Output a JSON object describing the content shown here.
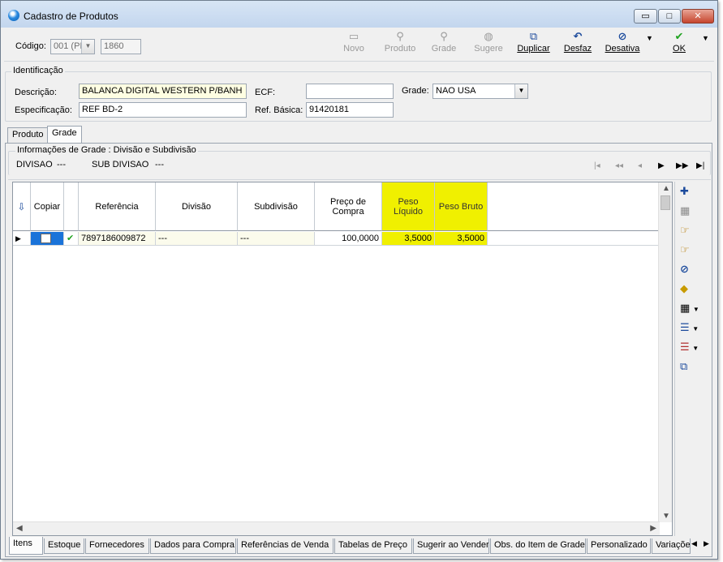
{
  "window": {
    "title": "Cadastro de Produtos",
    "controls": {
      "minimize": "▭",
      "maximize": "□",
      "close": "✕"
    }
  },
  "header": {
    "codigo_label": "Código:",
    "codigo_value": "001 (PI",
    "codigo_number": "1860"
  },
  "toolbar": {
    "items": [
      {
        "label": "Novo",
        "icon": "new-icon",
        "enabled": false
      },
      {
        "label": "Produto",
        "icon": "search-icon",
        "enabled": false
      },
      {
        "label": "Grade",
        "icon": "search-icon",
        "enabled": false
      },
      {
        "label": "Sugere",
        "icon": "suggest-icon",
        "enabled": false
      },
      {
        "label": "Duplicar",
        "icon": "duplicate-icon",
        "enabled": true
      },
      {
        "label": "Desfaz",
        "icon": "undo-icon",
        "enabled": true
      },
      {
        "label": "Desativa",
        "icon": "deactivate-icon",
        "enabled": true
      },
      {
        "label": "OK",
        "icon": "check-icon",
        "enabled": true
      }
    ],
    "accent": "#1b4a9c"
  },
  "identificacao": {
    "title": "Identificação",
    "descricao_label": "Descrição:",
    "descricao_value": "BALANCA DIGITAL WESTERN P/BANH",
    "ecf_label": "ECF:",
    "ecf_value": "",
    "grade_label": "Grade:",
    "grade_value": "NAO USA",
    "especificacao_label": "Especificação:",
    "especificacao_value": "REF BD-2",
    "ref_basica_label": "Ref. Básica:",
    "ref_basica_value": "91420181"
  },
  "page_tabs": [
    "Produto",
    "Grade"
  ],
  "active_page_tab": "Grade",
  "grade_info": {
    "title": "Informações de Grade : Divisão e Subdivisão",
    "divisao_label": "DIVISAO",
    "divisao_value": "---",
    "subdivisao_label": "SUB DIVISAO",
    "subdivisao_value": "---",
    "nav": [
      "|◂",
      "◂◂",
      "◂",
      "▶",
      "▶▶",
      "▶|"
    ]
  },
  "grid": {
    "columns": [
      "Copiar",
      "Referência",
      "Divisão",
      "Subdivisão",
      "Preço de Compra",
      "Peso Líquido",
      "Peso Bruto"
    ],
    "rows": [
      {
        "copiar": "",
        "referencia": "7897186009872",
        "divisao": "---",
        "subdivisao": "---",
        "preco_compra": "100,0000",
        "peso_liquido": "3,5000",
        "peso_bruto": "3,5000"
      }
    ],
    "highlight_color": "#f0f000"
  },
  "side_toolbar": [
    "add-row-icon",
    "delete-row-icon",
    "move-down-icon",
    "move-up-icon",
    "deactivate-icon",
    "diamond-icon",
    "layout-icon",
    "list-icon",
    "list-alt-icon",
    "copy-icon"
  ],
  "bottom_tabs": [
    "Itens",
    "Estoque",
    "Fornecedores",
    "Dados para Compra",
    "Referências de Venda",
    "Tabelas de Preço",
    "Sugerir ao Vender",
    "Obs. do Item de Grade",
    "Personalizado",
    "Variaçõe"
  ],
  "active_bottom_tab": "Itens"
}
